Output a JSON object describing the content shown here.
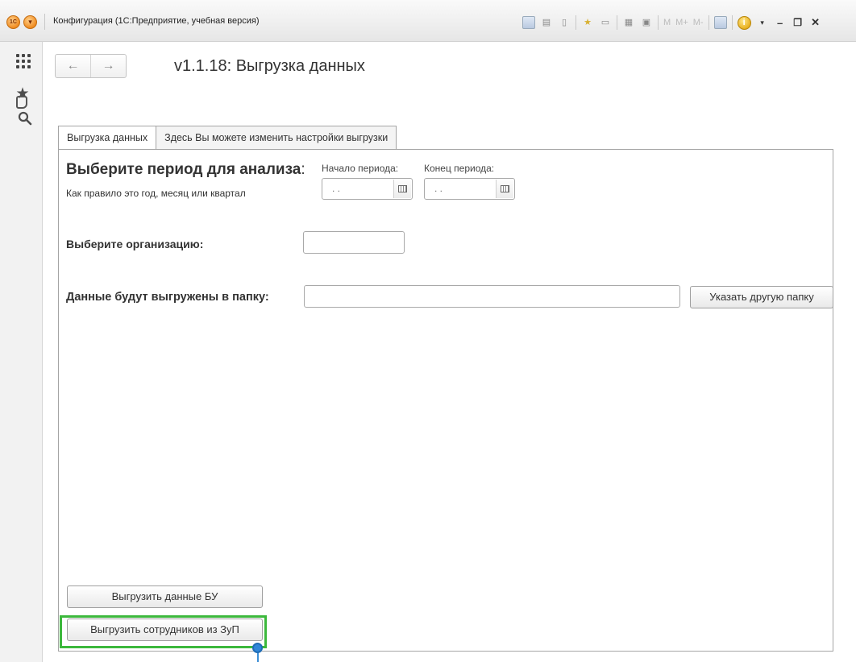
{
  "window": {
    "title": "Конфигурация  (1С:Предприятие, учебная версия)",
    "toolbar_text": {
      "m": "M",
      "m_plus": "M+",
      "m_minus": "M-"
    }
  },
  "page": {
    "title": "v1.1.18: Выгрузка данных",
    "nav": {
      "back": "←",
      "forward": "→"
    }
  },
  "tabs": [
    {
      "label": "Выгрузка данных",
      "active": true
    },
    {
      "label": "Здесь Вы можете изменить настройки выгрузки",
      "active": false
    }
  ],
  "period": {
    "heading": "Выберите период для анализа",
    "heading_suffix": ":",
    "subtext": "Как правило это год, месяц или квартал",
    "start": {
      "label": "Начало периода:",
      "value": " .  . "
    },
    "end": {
      "label": "Конец периода:",
      "value": " .  . "
    }
  },
  "organization": {
    "label": "Выберите организацию:",
    "value": ""
  },
  "folder": {
    "label": "Данные будут выгружены в папку",
    "label_suffix": ":",
    "value": "",
    "button": "Указать другую папку"
  },
  "actions": {
    "export_bu": "Выгрузить данные БУ",
    "export_employees": "Выгрузить сотрудников из ЗуП"
  },
  "colors": {
    "highlight": "#3cb83c",
    "pin": "#2f86d8"
  }
}
